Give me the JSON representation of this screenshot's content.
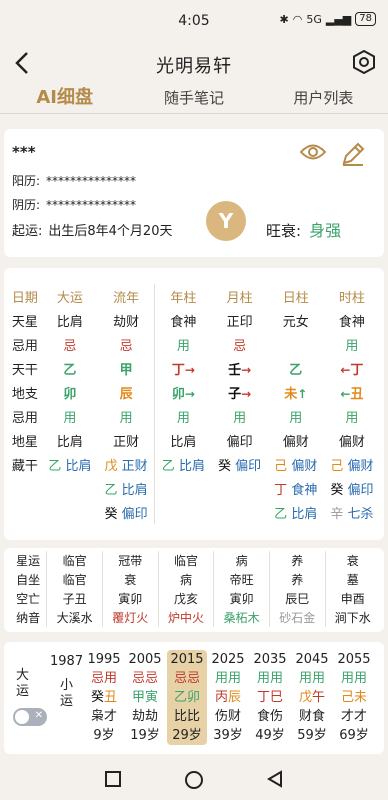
{
  "status": {
    "time": "4:05",
    "signal": "5G",
    "battery": "78"
  },
  "header": {
    "title": "光明易轩"
  },
  "tabs": [
    "AI细盘",
    "随手笔记",
    "用户列表"
  ],
  "info": {
    "name": "***",
    "yang_label": "阳历:",
    "yang_value": "***************",
    "yin_label": "阴历:",
    "yin_value": "***************",
    "qiyun_label": "起运:",
    "qiyun_value": "出生后8年4个月20天",
    "wangshuai_label": "旺衰:",
    "wangshuai_value": "身强",
    "logo_text": "Y"
  },
  "pan": {
    "head": [
      "日期",
      "大运",
      "流年",
      "年柱",
      "月柱",
      "日柱",
      "时柱"
    ],
    "tianxing": [
      "天星",
      "比肩",
      "劫财",
      "食神",
      "正印",
      "元女",
      "食神"
    ],
    "jiyong1": [
      "忌用",
      "忌",
      "忌",
      "用",
      "忌",
      "",
      ""
    ],
    "jiyong1_last": "用",
    "tiangan": [
      "天干",
      "乙",
      "甲",
      "丁",
      "壬",
      "乙",
      "丁"
    ],
    "dizhi": [
      "地支",
      "卯",
      "辰",
      "卯",
      "子",
      "未",
      "丑"
    ],
    "jiyong2": [
      "忌用",
      "用",
      "用",
      "用",
      "用",
      "用",
      "用"
    ],
    "dixing": [
      "地星",
      "比肩",
      "正财",
      "比肩",
      "偏印",
      "偏财",
      "偏财"
    ],
    "canggan": {
      "label": "藏干",
      "row1": [
        "乙",
        "比肩",
        "戊",
        "正财",
        "乙",
        "比肩",
        "癸",
        "偏印",
        "己",
        "偏财",
        "己",
        "偏财"
      ],
      "row2": [
        "乙",
        "比肩",
        "丁",
        "食神",
        "癸",
        "偏印"
      ],
      "row3": [
        "癸",
        "偏印",
        "乙",
        "比肩",
        "辛",
        "七杀"
      ]
    }
  },
  "star": {
    "rows": [
      [
        "星运",
        "临官",
        "冠带",
        "临官",
        "病",
        "养",
        "衰"
      ],
      [
        "自坐",
        "临官",
        "衰",
        "病",
        "帝旺",
        "养",
        "墓"
      ],
      [
        "空亡",
        "子丑",
        "寅卯",
        "戊亥",
        "寅卯",
        "辰巳",
        "申酉"
      ],
      [
        "纳音",
        "大溪水",
        "覆灯火",
        "炉中火",
        "桑柘木",
        "砂石金",
        "涧下水"
      ]
    ]
  },
  "yun": {
    "dayun_label": "大运",
    "xiaoyun_label": "小运",
    "first_year": "1987",
    "cols": [
      {
        "year": "1995",
        "a": "忌用",
        "b1": "癸",
        "b2": "丑",
        "c": "枭才",
        "d": "9岁"
      },
      {
        "year": "2005",
        "a": "忌忌",
        "b1": "甲",
        "b2": "寅",
        "c": "劫劫",
        "d": "19岁"
      },
      {
        "year": "2015",
        "a": "忌忌",
        "b1": "乙",
        "b2": "卯",
        "c": "比比",
        "d": "29岁"
      },
      {
        "year": "2025",
        "a": "用用",
        "b1": "丙",
        "b2": "辰",
        "c": "伤财",
        "d": "39岁"
      },
      {
        "year": "2035",
        "a": "用用",
        "b1": "丁",
        "b2": "巳",
        "c": "食伤",
        "d": "49岁"
      },
      {
        "year": "2045",
        "a": "用用",
        "b1": "戊",
        "b2": "午",
        "c": "财食",
        "d": "59岁"
      },
      {
        "year": "2055",
        "a": "用用",
        "b1": "己",
        "b2": "未",
        "c": "才才",
        "d": "69岁"
      }
    ]
  }
}
